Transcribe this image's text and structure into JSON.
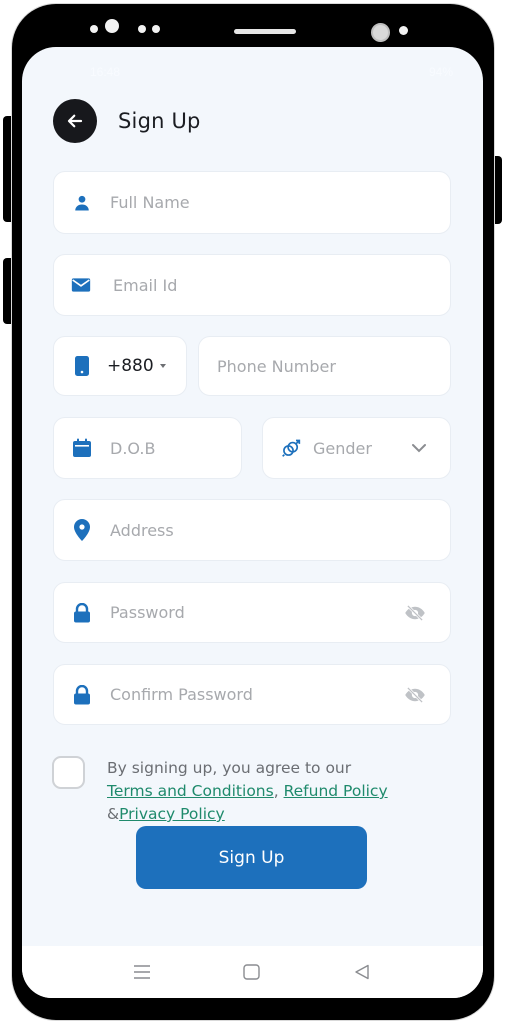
{
  "status_bar": {
    "time": "16:48",
    "right": "94%"
  },
  "header": {
    "back_icon": "arrow-left-icon",
    "title": "Sign Up"
  },
  "form": {
    "full_name": {
      "icon": "person-icon",
      "placeholder": "Full Name",
      "value": ""
    },
    "email": {
      "icon": "envelope-icon",
      "placeholder": "Email Id",
      "value": ""
    },
    "country_code": {
      "icon": "smartphone-icon",
      "value": "+880",
      "dropdown_icon": "caret-down-icon"
    },
    "phone": {
      "placeholder": "Phone Number",
      "value": ""
    },
    "dob": {
      "icon": "calendar-icon",
      "placeholder": "D.O.B",
      "value": ""
    },
    "gender": {
      "icon": "gender-icon",
      "placeholder": "Gender",
      "dropdown_icon": "chevron-down-icon"
    },
    "address": {
      "icon": "location-pin-icon",
      "placeholder": "Address",
      "value": ""
    },
    "password": {
      "icon": "lock-icon",
      "placeholder": "Password",
      "toggle_icon": "eye-off-icon",
      "value": ""
    },
    "confirm_password": {
      "icon": "lock-icon",
      "placeholder": "Confirm Password",
      "toggle_icon": "eye-off-icon",
      "value": ""
    }
  },
  "agreement": {
    "checked": false,
    "prefix": "By signing up, you agree to our ",
    "terms_link": "Terms and Conditions",
    "comma": ", ",
    "refund_link": "Refund Policy",
    "ampersand": "&",
    "privacy_link": "Privacy Policy"
  },
  "submit_label": "Sign Up",
  "nav_bar": {
    "items": [
      "menu-icon",
      "home-square-icon",
      "back-triangle-icon"
    ]
  },
  "colors": {
    "accent": "#1d70bc",
    "link": "#1f8a6c",
    "background": "#f3f7fc",
    "placeholder": "#a7a9ad"
  }
}
